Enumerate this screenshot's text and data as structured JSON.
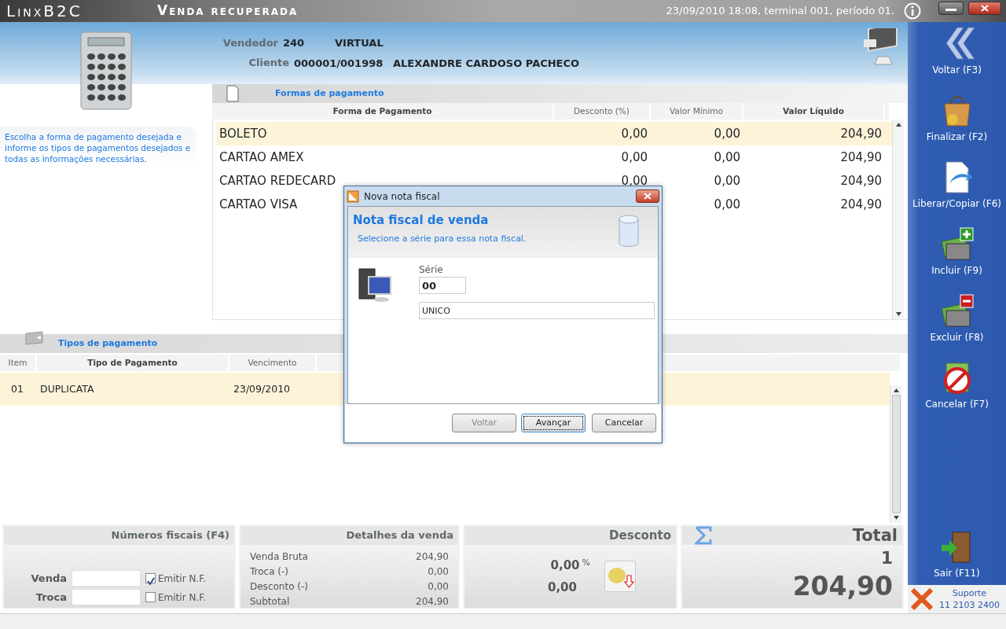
{
  "title_bar": {
    "app": "LinxB2C",
    "screen": "Venda recuperada",
    "status": "23/09/2010 18:08, terminal 001, período 01."
  },
  "header": {
    "vendedor_label": "Vendedor",
    "vendedor_code": "240",
    "vendedor_name": "VIRTUAL",
    "cliente_label": "Cliente",
    "cliente_code": "000001/001998",
    "cliente_name": "ALEXANDRE CARDOSO PACHECO"
  },
  "help_text": "Escolha a forma de pagamento desejada e informe os tipos de pagamentos desejados e todas as informações necessárias.",
  "formas": {
    "title": "Formas de pagamento",
    "columns": [
      "Forma de Pagamento",
      "Desconto (%)",
      "Valor Mínimo",
      "Valor Líquido"
    ],
    "rows": [
      {
        "forma": "BOLETO",
        "desconto": "0,00",
        "valor_minimo": "0,00",
        "valor_liquido": "204,90",
        "selected": true
      },
      {
        "forma": "CARTAO AMEX",
        "desconto": "0,00",
        "valor_minimo": "0,00",
        "valor_liquido": "204,90",
        "selected": false
      },
      {
        "forma": "CARTAO REDECARD",
        "desconto": "0,00",
        "valor_minimo": "0,00",
        "valor_liquido": "204,90",
        "selected": false
      },
      {
        "forma": "CARTAO VISA",
        "valor_minimo": "0,00",
        "valor_liquido": "204,90",
        "selected": false
      }
    ]
  },
  "tipos": {
    "title": "Tipos de pagamento",
    "columns": [
      "Item",
      "Tipo de Pagamento",
      "Vencimento"
    ],
    "rows": [
      {
        "cells": [
          "01",
          "DUPLICATA",
          "23/09/2010"
        ],
        "selected": true
      }
    ]
  },
  "numeros_fiscais": {
    "title": "Números fiscais (F4)",
    "fields": [
      {
        "label": "Venda",
        "checkbox_label": "Emitir N.F.",
        "checked": true
      },
      {
        "label": "Troca",
        "checkbox_label": "Emitir N.F.",
        "checked": false
      }
    ]
  },
  "detalhes": {
    "title": "Detalhes da venda",
    "rows": [
      {
        "label": "Venda Bruta",
        "value": "204,90"
      },
      {
        "label": "Troca (-)",
        "value": "0,00"
      },
      {
        "label": "Desconto (-)",
        "value": "0,00"
      },
      {
        "label": "Subtotal",
        "value": "204,90"
      }
    ]
  },
  "desconto": {
    "title": "Desconto",
    "percent": "0,00",
    "percent_sign": "%",
    "value": "0,00"
  },
  "total": {
    "title": "Total",
    "count": "1",
    "value": "204,90"
  },
  "sidebar": {
    "buttons": [
      {
        "label": "Voltar (F3)",
        "kind": "back"
      },
      {
        "label": "Finalizar (F2)",
        "kind": "bag"
      },
      {
        "label": "Liberar/Copiar (F6)",
        "kind": "document"
      },
      {
        "label": "Incluir (F9)",
        "kind": "add"
      },
      {
        "label": "Excluir (F8)",
        "kind": "remove"
      },
      {
        "label": "Cancelar (F7)",
        "kind": "cancel"
      }
    ],
    "exit_button": {
      "label": "Sair (F11)",
      "kind": "door"
    },
    "support": {
      "label": "Suporte",
      "phone": "11 2103 2400"
    }
  },
  "dialog": {
    "title": "Nova nota fiscal",
    "heading": "Nota fiscal de venda",
    "subtitle": "Selecione a série para essa nota fiscal.",
    "serie_label": "Série",
    "serie_value": "00",
    "serie_description": "UNICO",
    "buttons": [
      {
        "label": "Voltar",
        "disabled": true,
        "focused": false
      },
      {
        "label": "Avançar",
        "disabled": false,
        "focused": true
      },
      {
        "label": "Cancelar",
        "disabled": false,
        "focused": false
      }
    ]
  }
}
